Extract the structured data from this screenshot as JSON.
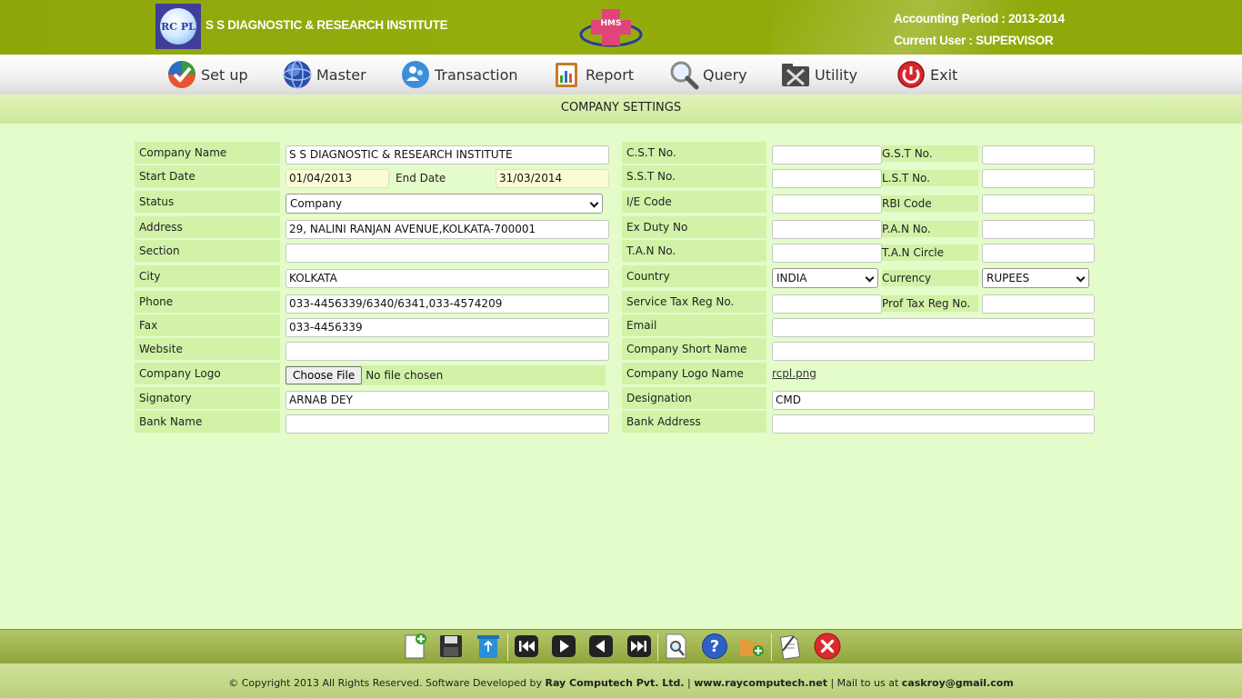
{
  "header": {
    "logo_text": "RC PL",
    "institute_name": "S S DIAGNOSTIC & RESEARCH INSTITUTE",
    "hms_logo_text": "HMS",
    "accounting_period": "Accounting Period : 2013-2014",
    "current_user": "Current User : SUPERVISOR"
  },
  "menu": [
    {
      "label": "Set up",
      "icon": "checkmark-icon"
    },
    {
      "label": "Master",
      "icon": "globe-icon"
    },
    {
      "label": "Transaction",
      "icon": "people-icon"
    },
    {
      "label": "Report",
      "icon": "report-icon"
    },
    {
      "label": "Query",
      "icon": "magnifier-icon"
    },
    {
      "label": "Utility",
      "icon": "tools-icon"
    },
    {
      "label": "Exit",
      "icon": "power-icon"
    }
  ],
  "page_title": "COMPANY SETTINGS",
  "form": {
    "company_name": {
      "label": "Company Name",
      "value": "S S DIAGNOSTIC & RESEARCH INSTITUTE"
    },
    "start_date": {
      "label": "Start Date",
      "value": "01/04/2013"
    },
    "end_date": {
      "label": "End Date",
      "value": "31/03/2014"
    },
    "status": {
      "label": "Status",
      "value": "Company"
    },
    "address": {
      "label": "Address",
      "value": "29, NALINI RANJAN AVENUE,KOLKATA-700001"
    },
    "section": {
      "label": "Section",
      "value": ""
    },
    "city": {
      "label": "City",
      "value": "KOLKATA"
    },
    "phone": {
      "label": "Phone",
      "value": "033-4456339/6340/6341,033-4574209"
    },
    "fax": {
      "label": "Fax",
      "value": "033-4456339"
    },
    "website": {
      "label": "Website",
      "value": ""
    },
    "company_logo": {
      "label": "Company Logo",
      "button": "Choose File",
      "status": "No file chosen"
    },
    "signatory": {
      "label": "Signatory",
      "value": "ARNAB DEY"
    },
    "bank_name": {
      "label": "Bank Name",
      "value": ""
    },
    "cst_no": {
      "label": "C.S.T No.",
      "value": ""
    },
    "gst_no": {
      "label": "G.S.T No.",
      "value": ""
    },
    "sst_no": {
      "label": "S.S.T No.",
      "value": ""
    },
    "lst_no": {
      "label": "L.S.T No.",
      "value": ""
    },
    "ie_code": {
      "label": "I/E Code",
      "value": ""
    },
    "rbi_code": {
      "label": "RBI Code",
      "value": ""
    },
    "ex_duty_no": {
      "label": "Ex Duty No",
      "value": ""
    },
    "pan_no": {
      "label": "P.A.N No.",
      "value": ""
    },
    "tan_no": {
      "label": "T.A.N No.",
      "value": ""
    },
    "tan_circle": {
      "label": "T.A.N Circle",
      "value": ""
    },
    "country": {
      "label": "Country",
      "value": "INDIA"
    },
    "currency": {
      "label": "Currency",
      "value": "RUPEES"
    },
    "service_tax_reg_no": {
      "label": "Service Tax Reg No.",
      "value": ""
    },
    "prof_tax_reg_no": {
      "label": "Prof Tax Reg No.",
      "value": ""
    },
    "email": {
      "label": "Email",
      "value": ""
    },
    "company_short_name": {
      "label": "Company Short Name",
      "value": ""
    },
    "company_logo_name": {
      "label": "Company Logo Name",
      "value": "rcpl.png"
    },
    "designation": {
      "label": "Designation",
      "value": "CMD"
    },
    "bank_address": {
      "label": "Bank Address",
      "value": ""
    }
  },
  "toolbar": [
    "new-icon",
    "save-icon",
    "delete-icon",
    "first-record-icon",
    "next-icon",
    "previous-icon",
    "last-record-icon",
    "search-icon",
    "help-icon",
    "open-folder-icon",
    "notes-icon",
    "close-icon"
  ],
  "footer": {
    "copyright": "© Copyright 2013 All Rights Reserved. Software Developed by ",
    "company": "Ray Computech Pvt. Ltd.",
    "sep1": " | ",
    "website": "www.raycomputech.net",
    "mail_text": " | Mail to us at ",
    "email": "caskroy@gmail.com"
  },
  "colors": {
    "header_green": "#8ea60a",
    "page_background": "#e4fcc9",
    "label_background": "#d2f2a8"
  }
}
